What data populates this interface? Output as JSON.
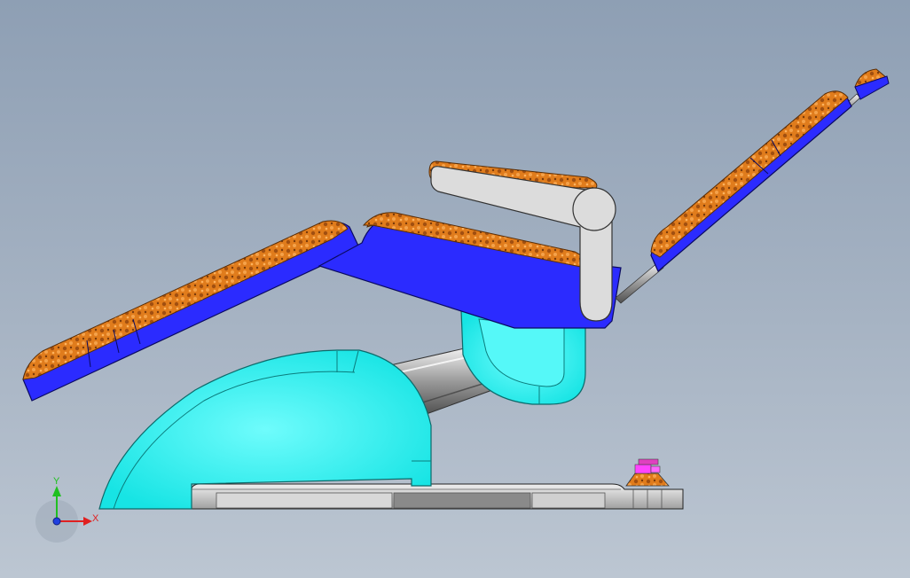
{
  "viewport": {
    "type": "3d-cad-viewport",
    "model": "dental-chair",
    "background_top": "#8e9fb4",
    "background_bottom": "#bcc6d2"
  },
  "colors": {
    "upholstery_frame": "#2b2bff",
    "cushion": "#e07c1c",
    "base_cover": "#21f6f6",
    "armrest": "#dcdcdc",
    "floor_plate": "#c8c8c8",
    "foot_control": "#d77a2a",
    "foot_control_top": "#ff44ff"
  },
  "triad": {
    "x_label": "X",
    "y_label": "Y",
    "x_color": "#e02020",
    "y_color": "#20c020",
    "z_color": "#2040e0"
  }
}
